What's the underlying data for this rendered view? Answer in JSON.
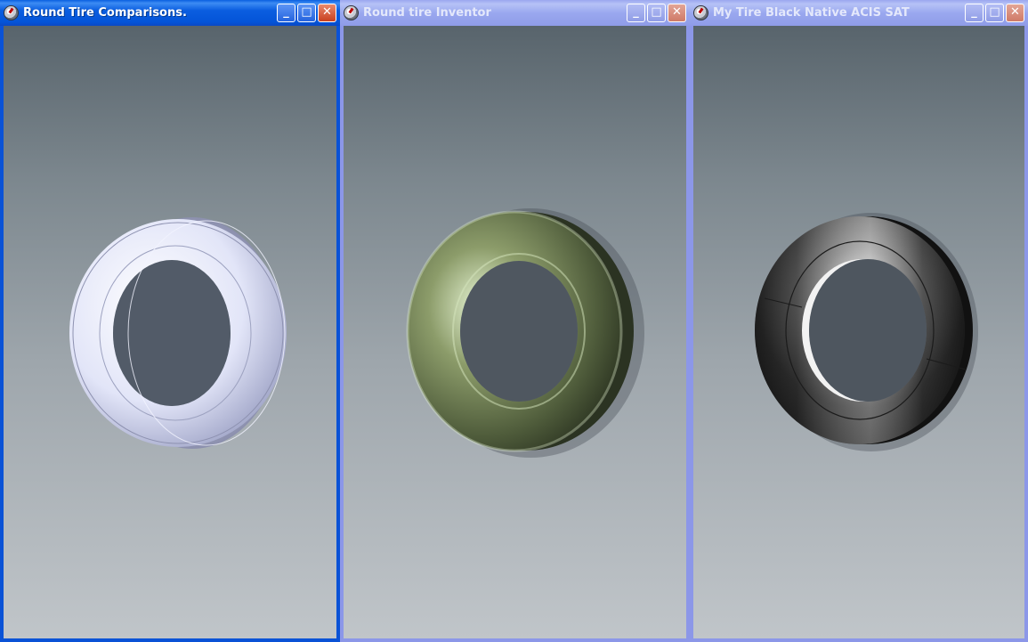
{
  "windows": [
    {
      "title": "Round Tire Comparisons.",
      "active": true,
      "buttons": {
        "minimize": "_",
        "maximize": "□",
        "close": "✕"
      },
      "app_icon": "app-icon",
      "tire_color": "#dfe2f6"
    },
    {
      "title": "Round tire Inventor",
      "active": false,
      "buttons": {
        "minimize": "_",
        "maximize": "□",
        "close": "✕"
      },
      "app_icon": "app-icon",
      "tire_color": "#6f7f55"
    },
    {
      "title": "My Tire Black Native ACIS SAT",
      "active": false,
      "buttons": {
        "minimize": "_",
        "maximize": "□",
        "close": "✕"
      },
      "app_icon": "app-icon",
      "tire_color": "#1e1e1e"
    }
  ]
}
